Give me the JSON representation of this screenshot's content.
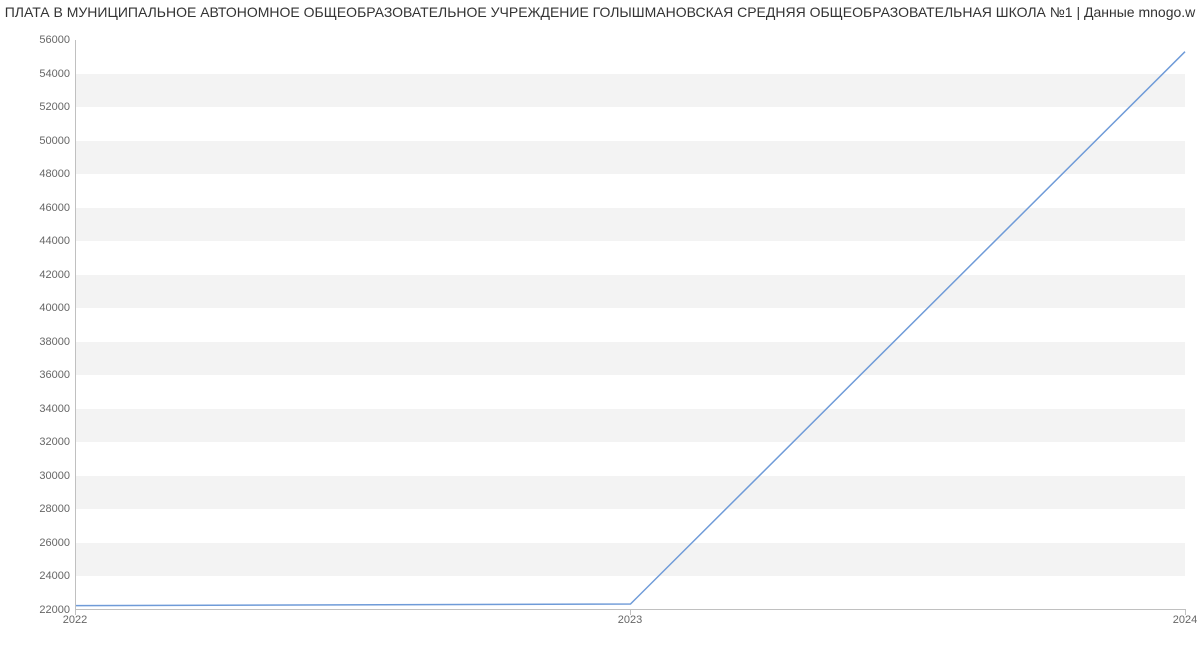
{
  "title": "ПЛАТА В МУНИЦИПАЛЬНОЕ АВТОНОМНОЕ ОБЩЕОБРАЗОВАТЕЛЬНОЕ УЧРЕЖДЕНИЕ ГОЛЫШМАНОВСКАЯ СРЕДНЯЯ ОБЩЕОБРАЗОВАТЕЛЬНАЯ ШКОЛА №1 | Данные mnogo.w",
  "chart_data": {
    "type": "line",
    "title": "ПЛАТА В МУНИЦИПАЛЬНОЕ АВТОНОМНОЕ ОБЩЕОБРАЗОВАТЕЛЬНОЕ УЧРЕЖДЕНИЕ ГОЛЫШМАНОВСКАЯ СРЕДНЯЯ ОБЩЕОБРАЗОВАТЕЛЬНАЯ ШКОЛА №1 | Данные mnogo.w",
    "x": [
      2022,
      2023,
      2024
    ],
    "values": [
      22200,
      22300,
      55300
    ],
    "xlabel": "",
    "ylabel": "",
    "ylim": [
      22000,
      56000
    ],
    "yticks": [
      22000,
      24000,
      26000,
      28000,
      30000,
      32000,
      34000,
      36000,
      38000,
      40000,
      42000,
      44000,
      46000,
      48000,
      50000,
      52000,
      54000,
      56000
    ],
    "xticks": [
      2022,
      2023,
      2024
    ]
  },
  "yticklabels": {
    "0": "22000",
    "1": "24000",
    "2": "26000",
    "3": "28000",
    "4": "30000",
    "5": "32000",
    "6": "34000",
    "7": "36000",
    "8": "38000",
    "9": "40000",
    "10": "42000",
    "11": "44000",
    "12": "46000",
    "13": "48000",
    "14": "50000",
    "15": "52000",
    "16": "54000",
    "17": "56000"
  },
  "xticklabels": {
    "0": "2022",
    "1": "2023",
    "2": "2024"
  }
}
